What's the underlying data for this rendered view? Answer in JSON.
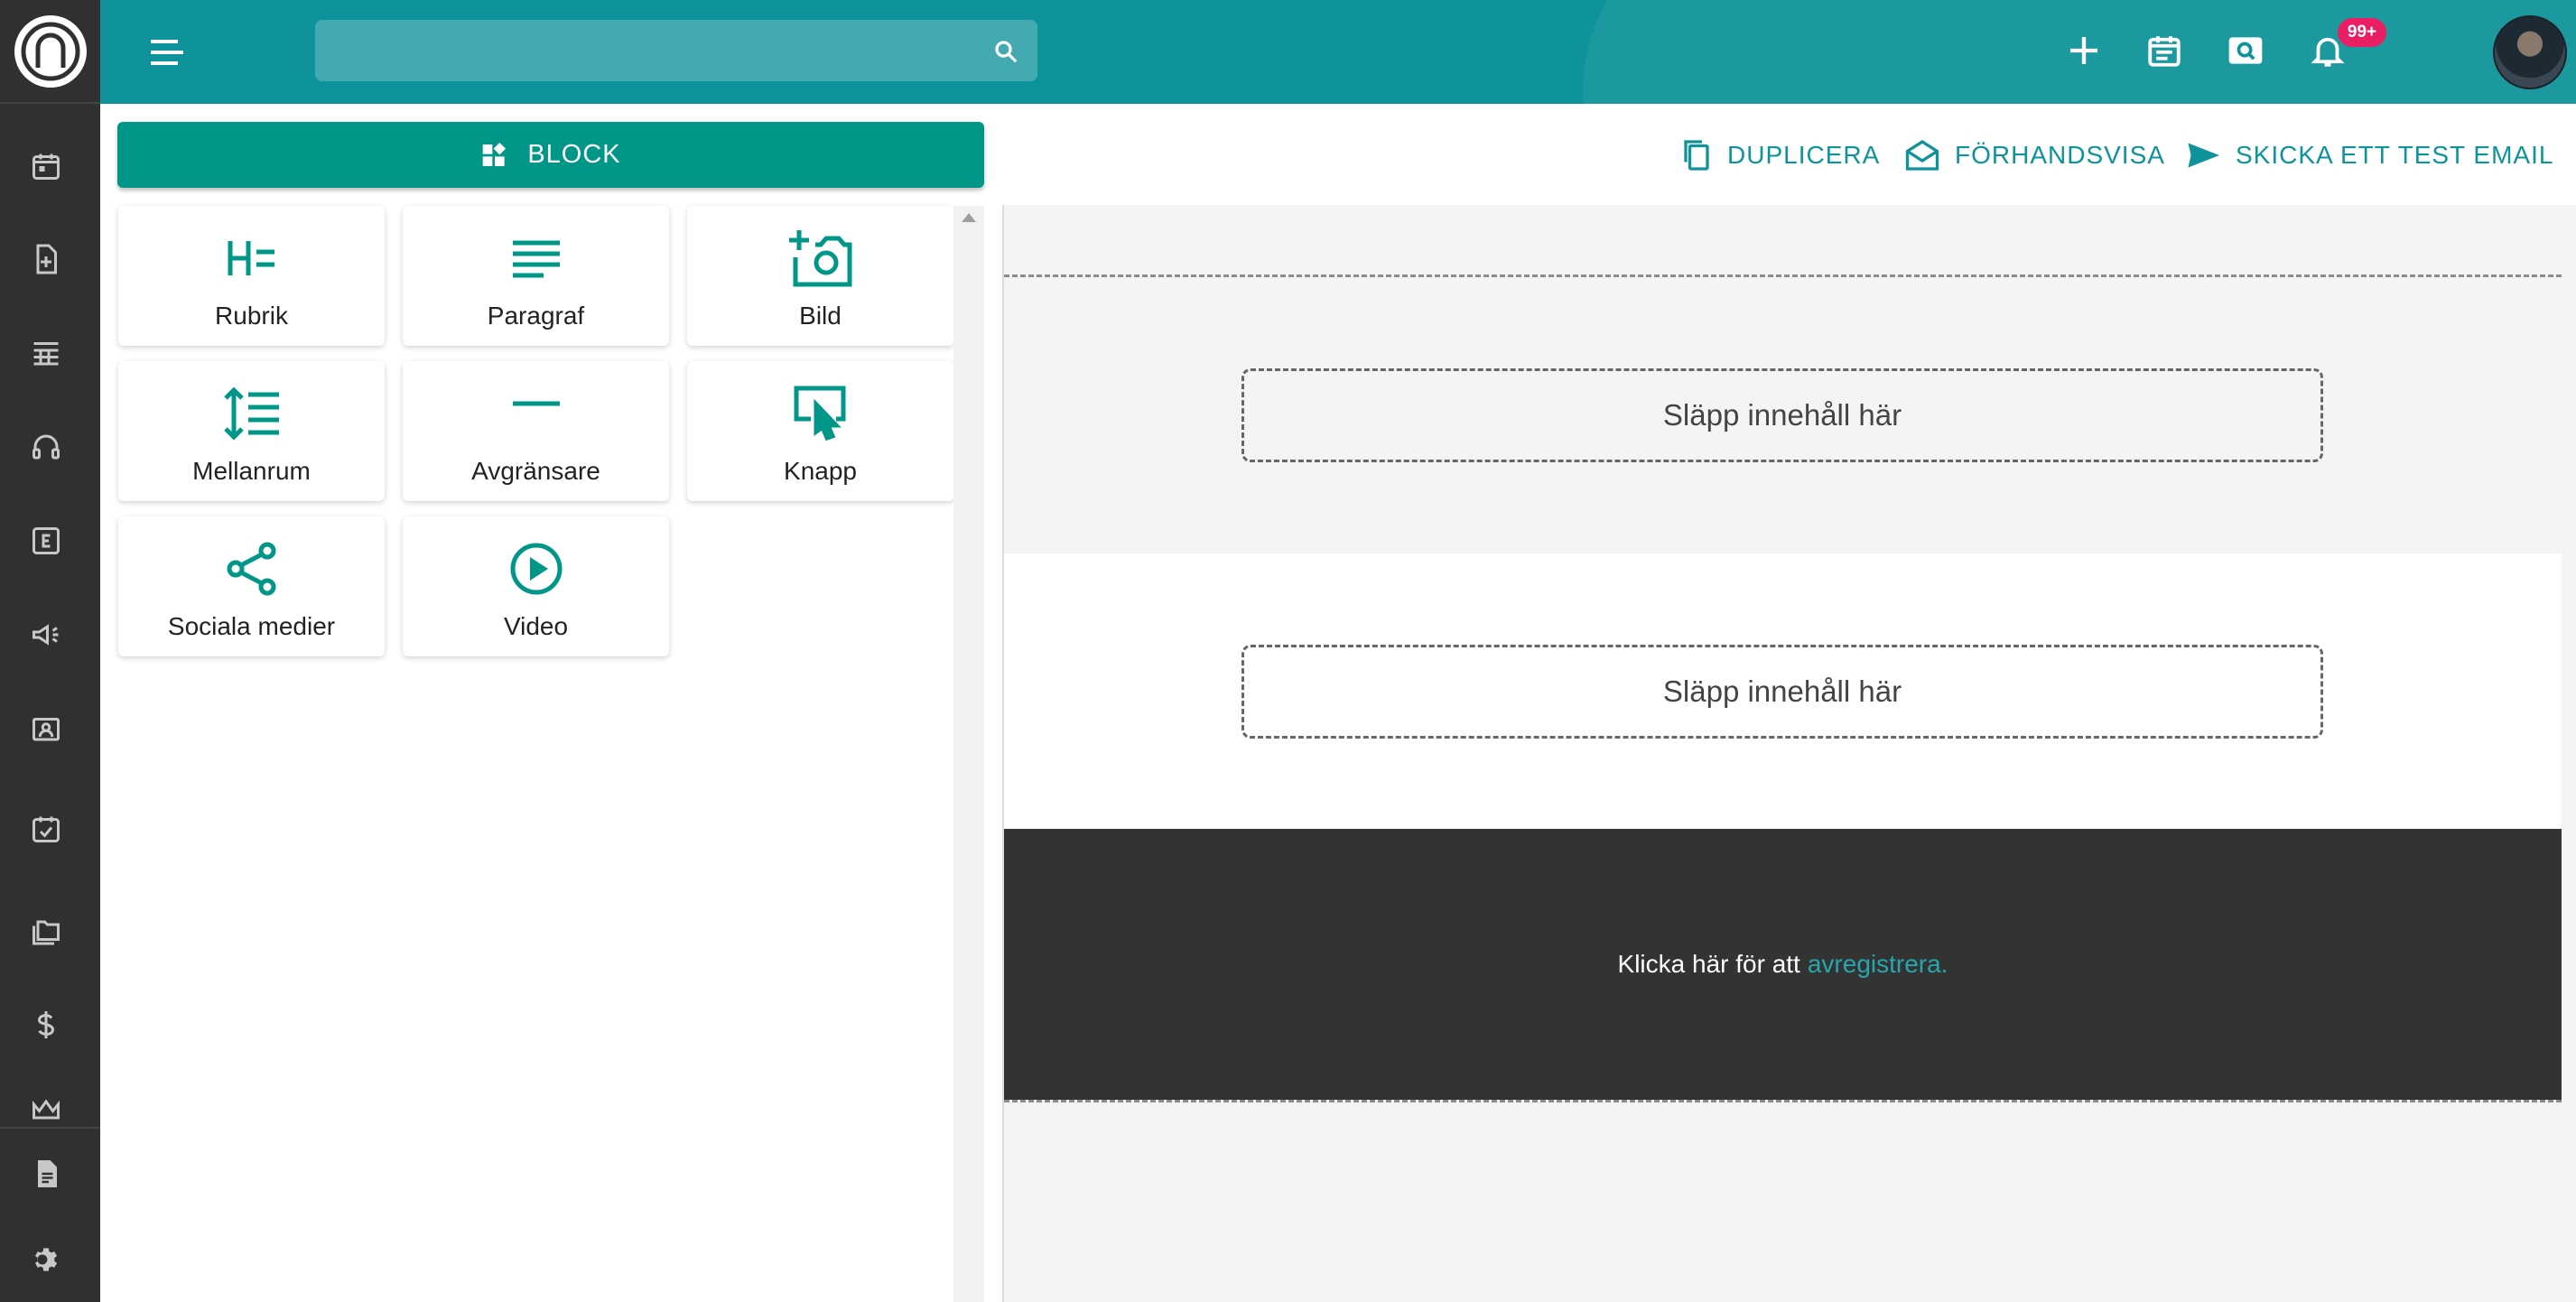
{
  "search": {
    "placeholder": "",
    "value": ""
  },
  "notifications": {
    "badge": "99+"
  },
  "panel": {
    "block_label": "BLOCK",
    "tiles": [
      {
        "label": "Rubrik",
        "icon": "heading-icon"
      },
      {
        "label": "Paragraf",
        "icon": "paragraph-icon"
      },
      {
        "label": "Bild",
        "icon": "add-photo-icon"
      },
      {
        "label": "Mellanrum",
        "icon": "spacing-icon"
      },
      {
        "label": "Avgränsare",
        "icon": "divider-icon"
      },
      {
        "label": "Knapp",
        "icon": "button-click-icon"
      },
      {
        "label": "Sociala medier",
        "icon": "share-icon"
      },
      {
        "label": "Video",
        "icon": "play-circle-icon"
      }
    ]
  },
  "toolbar": {
    "duplicate": "DUPLICERA",
    "preview": "FÖRHANDSVISA",
    "send_test": "SKICKA ETT TEST EMAIL"
  },
  "canvas": {
    "drop_1": "Släpp innehåll här",
    "drop_2": "Släpp innehåll här",
    "footer_text": "Klicka här för att",
    "footer_link": "avregistrera."
  },
  "colors": {
    "topbar": "#0e939a",
    "accent": "#009688",
    "rail": "#303030",
    "badge": "#e91e63",
    "footer": "#333333"
  }
}
